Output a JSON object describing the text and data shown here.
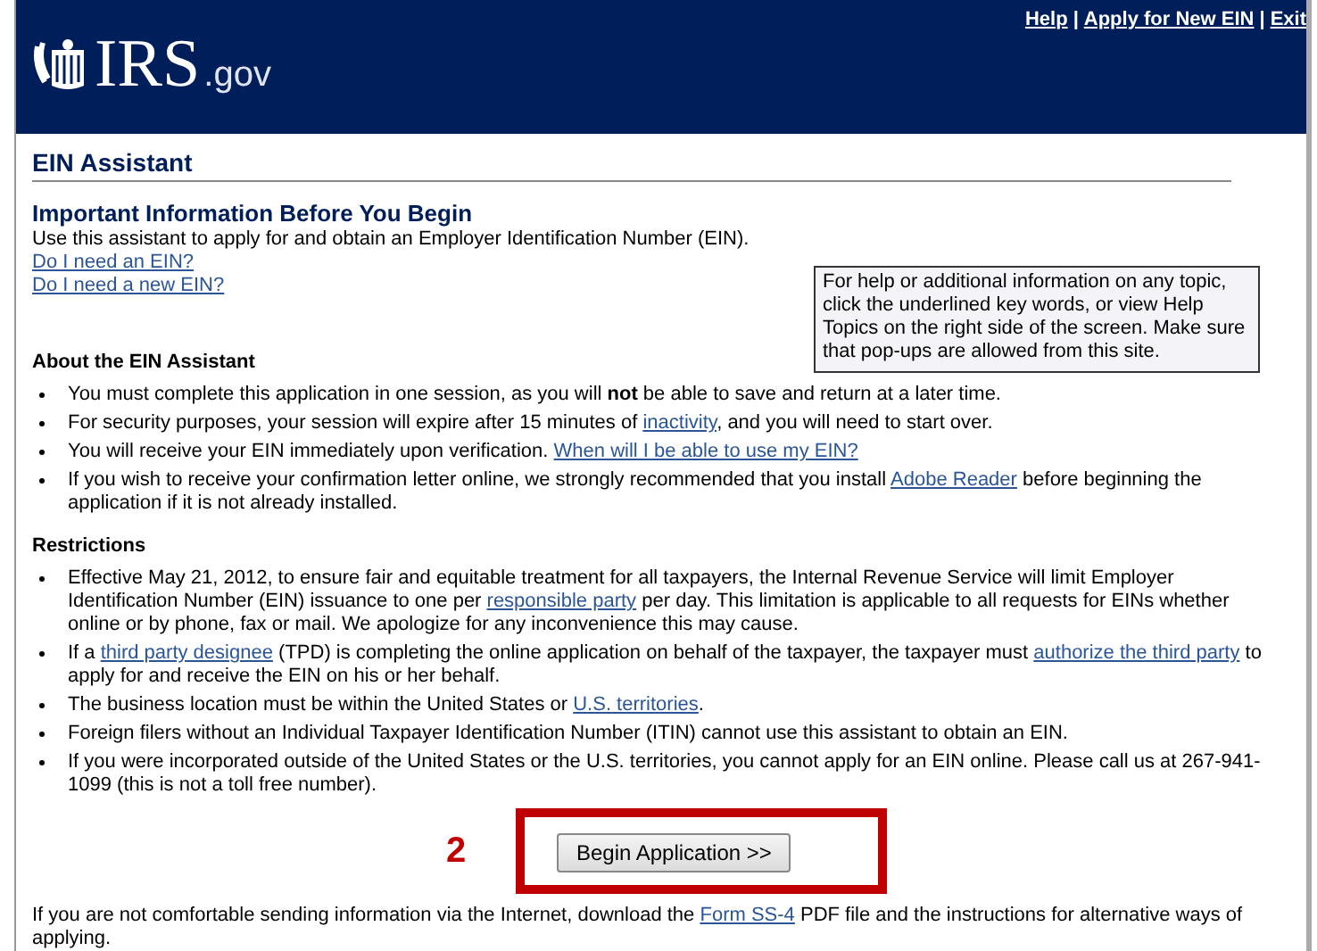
{
  "header": {
    "logo": {
      "wordmark": "IRS",
      "suffix": ".gov"
    },
    "nav_links": [
      "Help",
      "Apply for New EIN",
      "Exit"
    ],
    "separator": "|"
  },
  "page_title": "EIN Assistant",
  "intro": {
    "heading": "Important Information Before You Begin",
    "text": "Use this assistant to apply for and obtain an Employer Identification Number (EIN).",
    "links": [
      "Do I need an EIN?",
      "Do I need a new EIN?"
    ]
  },
  "help_box": "For help or additional information on any topic, click the underlined key words, or view Help Topics on the right side of the screen. Make sure that pop-ups are allowed from this site.",
  "sections": [
    {
      "heading": "About the EIN Assistant",
      "items": [
        [
          {
            "text": "You must complete this application in one session, as you will **not** be able to save and return at a later time."
          }
        ],
        [
          {
            "text": "For security purposes, your session will expire after 15 minutes of "
          },
          {
            "link": "inactivity"
          },
          {
            "text": ", and you will need to start over."
          }
        ],
        [
          {
            "text": "You will receive your EIN immediately upon verification. "
          },
          {
            "link": "When will I be able to use my EIN?"
          }
        ],
        [
          {
            "text": "If you wish to receive your confirmation letter online, we strongly recommended that you install "
          },
          {
            "link": "Adobe Reader"
          },
          {
            "text": " before beginning the application if it is not already installed."
          }
        ]
      ]
    },
    {
      "heading": "Restrictions",
      "items": [
        [
          {
            "text": "Effective May 21, 2012, to ensure fair and equitable treatment for all taxpayers, the Internal Revenue Service will limit Employer Identification Number (EIN) issuance to one per "
          },
          {
            "link": "responsible party"
          },
          {
            "text": " per day. This limitation is applicable to all requests for EINs whether online or by phone, fax or mail.  We apologize for any inconvenience this may cause."
          }
        ],
        [
          {
            "text": "If a "
          },
          {
            "link": "third party designee"
          },
          {
            "text": " (TPD) is completing the online application on behalf of the taxpayer, the taxpayer must "
          },
          {
            "link": "authorize the third party"
          },
          {
            "text": " to apply for and receive the EIN on his or her behalf."
          }
        ],
        [
          {
            "text": "The business location must be within the United States or "
          },
          {
            "link": "U.S. territories"
          },
          {
            "text": "."
          }
        ],
        [
          {
            "text": "Foreign filers without an Individual Taxpayer Identification Number (ITIN) cannot use this assistant to obtain an EIN."
          }
        ],
        [
          {
            "text": "If you were incorporated outside of the United States or the U.S. territories, you cannot apply for an EIN online. Please call us at 267-941-1099 (this is not a toll free number)."
          }
        ]
      ]
    }
  ],
  "annotation": {
    "label": "2"
  },
  "begin_button": "Begin Application >>",
  "footer": [
    {
      "text": "If you are not comfortable sending information via the Internet, download the "
    },
    {
      "link": "Form SS-4"
    },
    {
      "text": " PDF file and the instructions for alternative ways of applying."
    }
  ]
}
